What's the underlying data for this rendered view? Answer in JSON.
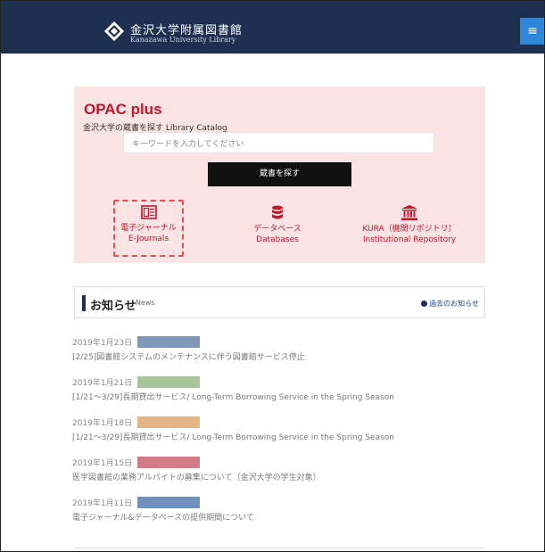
{
  "header": {
    "title_ja": "金沢大学附属図書館",
    "title_en": "Kanazawa University Library",
    "menu_icon": "≡"
  },
  "opac": {
    "title": "OPAC plus",
    "subtitle": "金沢大学の蔵書を探す Library Catalog",
    "search_placeholder": "キーワードを入力してください",
    "search_button": "蔵書を探す",
    "features": [
      {
        "label_ja": "電子ジャーナル",
        "label_en": "E-Journals"
      },
      {
        "label_ja": "データベース",
        "label_en": "Databases"
      },
      {
        "label_ja": "KURA（機関リポジトリ）",
        "label_en": "Institutional Repository"
      }
    ]
  },
  "news": {
    "title": "お知らせ",
    "subtitle": "News",
    "past_link": "過去のお知らせ",
    "items": [
      {
        "date": "2019年1月23日",
        "text": "[2/25]図書館システムのメンテナンスに伴う図書館サービス停止",
        "tag_color": "#7f97b8"
      },
      {
        "date": "2019年1月21日",
        "text": "[1/21～3/29]長期貸出サービス/ Long-Term Borrowing Service in the Spring Season",
        "tag_color": "#a8c59a"
      },
      {
        "date": "2019年1月18日",
        "text": "[1/21～3/29]長期貸出サービス/ Long-Term Borrowing Service in the Spring Season",
        "tag_color": "#e6b586"
      },
      {
        "date": "2019年1月15日",
        "text": "医学図書館の業務アルバイトの募集について（金沢大学の学生対象）",
        "tag_color": "#d27b84"
      },
      {
        "date": "2019年1月11日",
        "text": "電子ジャーナル&データベースの提供期間について",
        "tag_color": "#6f8fc0"
      }
    ]
  }
}
